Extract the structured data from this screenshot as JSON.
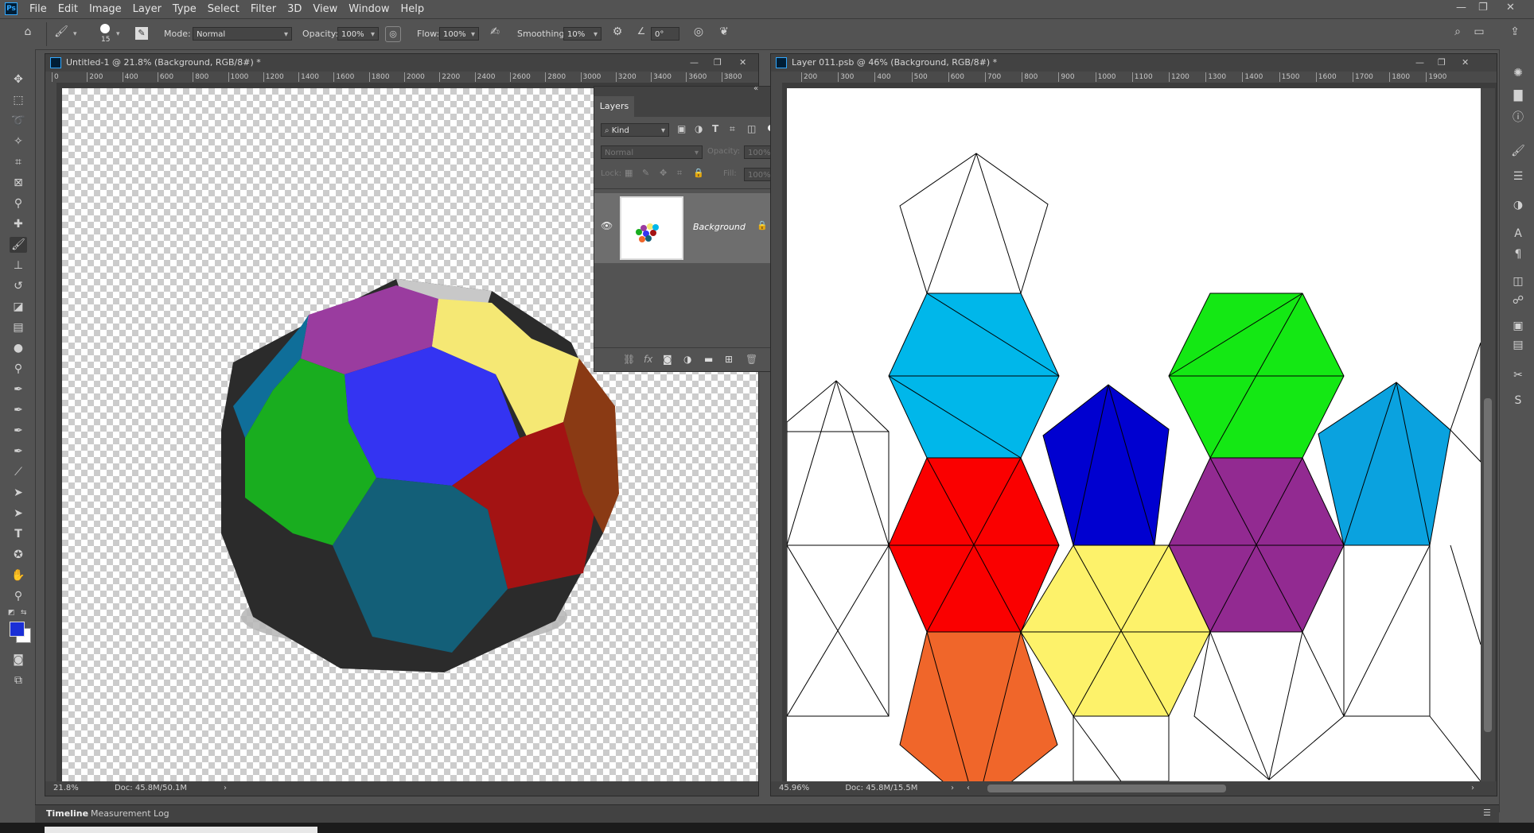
{
  "menu": {
    "app_icon": "Ps",
    "items": [
      "File",
      "Edit",
      "Image",
      "Layer",
      "Type",
      "Select",
      "Filter",
      "3D",
      "View",
      "Window",
      "Help"
    ]
  },
  "options": {
    "brush_size": "15",
    "mode_label": "Mode:",
    "mode_value": "Normal",
    "opacity_label": "Opacity:",
    "opacity_value": "100%",
    "flow_label": "Flow:",
    "flow_value": "100%",
    "smoothing_label": "Smoothing:",
    "smoothing_value": "10%",
    "angle_value": "0°"
  },
  "doc1": {
    "title": "Untitled-1 @ 21.8% (Background, RGB/8#) *",
    "ruler_ticks": [
      "0",
      "200",
      "400",
      "600",
      "800",
      "1000",
      "1200",
      "1400",
      "1600",
      "1800",
      "2000",
      "2200",
      "2400",
      "2600",
      "2800",
      "3000",
      "3200",
      "3400",
      "3600",
      "3800"
    ],
    "zoom": "21.8%",
    "doc_size": "Doc: 45.8M/50.1M"
  },
  "doc2": {
    "title": "Layer 011.psb @ 46% (Background, RGB/8#) *",
    "ruler_ticks": [
      "200",
      "300",
      "400",
      "500",
      "600",
      "700",
      "800",
      "900",
      "1000",
      "1100",
      "1200",
      "1300",
      "1400",
      "1500",
      "1600",
      "1700",
      "1800",
      "1900"
    ],
    "zoom": "45.96%",
    "doc_size": "Doc: 45.8M/15.5M"
  },
  "layers_panel": {
    "tab": "Layers",
    "filter_kind": "Kind",
    "blend_mode": "Normal",
    "opacity_label": "Opacity:",
    "opacity_value": "100%",
    "lock_label": "Lock:",
    "fill_label": "Fill:",
    "fill_value": "100%",
    "layer_name": "Background"
  },
  "bottom_tabs": [
    "Timeline",
    "Measurement Log"
  ],
  "colors": {
    "foreground": "#1a2fd6",
    "background": "#ffffff",
    "purple": "#9a3c9f",
    "yellow": "#f5e874",
    "blue": "#3434f2",
    "green": "#19ad1f",
    "teal": "#135f78",
    "red": "#a31313",
    "brown": "#8a3a14",
    "darkblue": "#0f6e99",
    "cyan": "#00b7ea",
    "lime": "#14e814",
    "navy": "#0000d0",
    "skyblue": "#0aa2df",
    "netred": "#fa0000",
    "netpurple": "#922a91",
    "netyellow": "#fdf26a",
    "orange": "#f0662a"
  }
}
